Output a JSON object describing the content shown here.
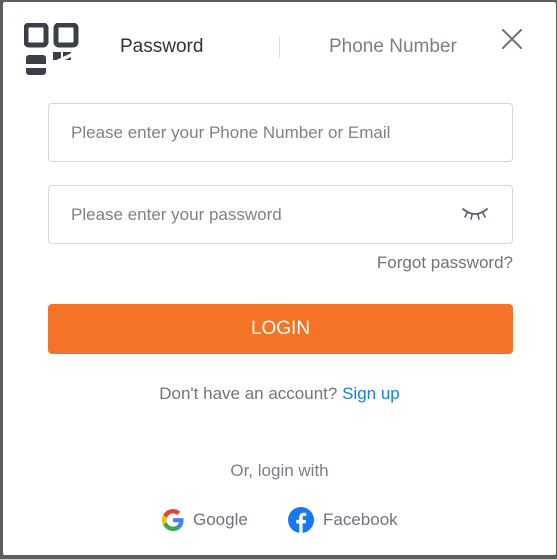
{
  "tabs": {
    "password_label": "Password",
    "phone_label": "Phone Number"
  },
  "icons": {
    "qr": "qr-code-icon",
    "close": "close-icon",
    "eye": "eye-closed-icon",
    "google": "google-icon",
    "facebook": "facebook-icon"
  },
  "form": {
    "account_placeholder": "Please enter your Phone Number or Email",
    "account_value": "",
    "password_placeholder": "Please enter your password",
    "password_value": "",
    "forgot_label": "Forgot password?",
    "login_label": "LOGIN"
  },
  "signup": {
    "prompt": "Don't have an account?",
    "link_label": "Sign up"
  },
  "social": {
    "heading": "Or, login with",
    "google_label": "Google",
    "facebook_label": "Facebook"
  },
  "colors": {
    "accent": "#f47326",
    "link": "#1a7ee0",
    "facebook": "#1877f2"
  }
}
